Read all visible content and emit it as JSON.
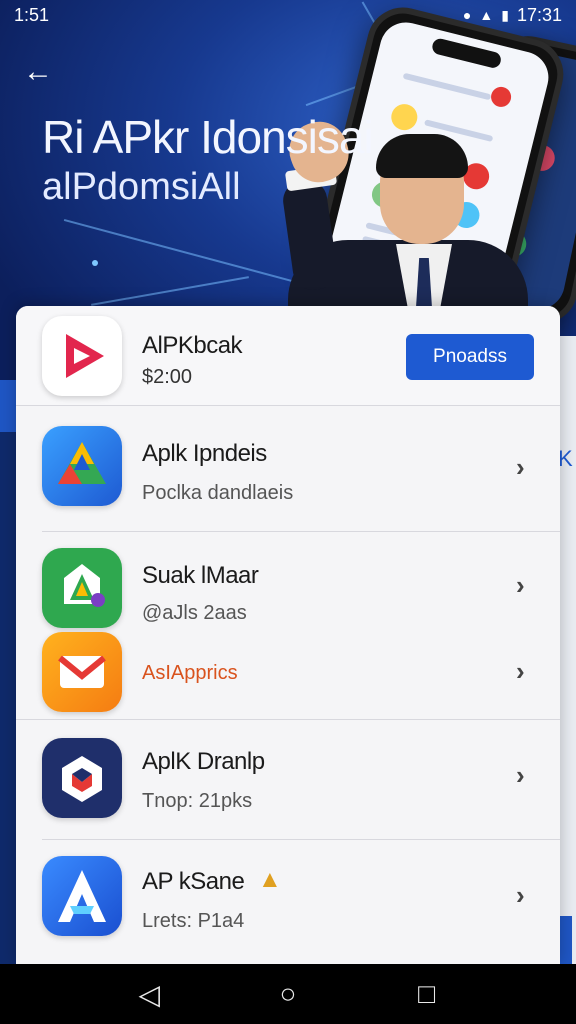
{
  "status_bar": {
    "time_left": "1:51",
    "time_right": "17:31"
  },
  "hero": {
    "title": "Ri APkr Idonsisai",
    "subtitle": "alPdomsiAll"
  },
  "featured": {
    "name": "AlPKbcak",
    "price": "$2:00",
    "button_label": "Pnoadss"
  },
  "apps": [
    {
      "name": "Aplk Ipndeis",
      "meta": "Poclka dandlaeis",
      "icon": "drive-like-icon",
      "meta_color": "#555555"
    },
    {
      "name": "Suak lMaar",
      "meta": "@aJls 2aas",
      "icon": "green-a-icon",
      "meta_color": "#555555"
    },
    {
      "name": "",
      "meta": "AsIApprics",
      "icon": "mail-icon",
      "meta_color": "#d9531e"
    },
    {
      "name": "AplK Dranlp",
      "meta": "Tnop: 21pks",
      "icon": "shield-icon",
      "meta_color": "#555555"
    },
    {
      "name": "AP kSane",
      "meta": "Lrets: P1a4",
      "icon": "a-logo-icon",
      "meta_color": "#555555"
    }
  ],
  "side_text": "K",
  "colors": {
    "accent": "#1e5ad2",
    "hero_bg": "#17398f"
  }
}
